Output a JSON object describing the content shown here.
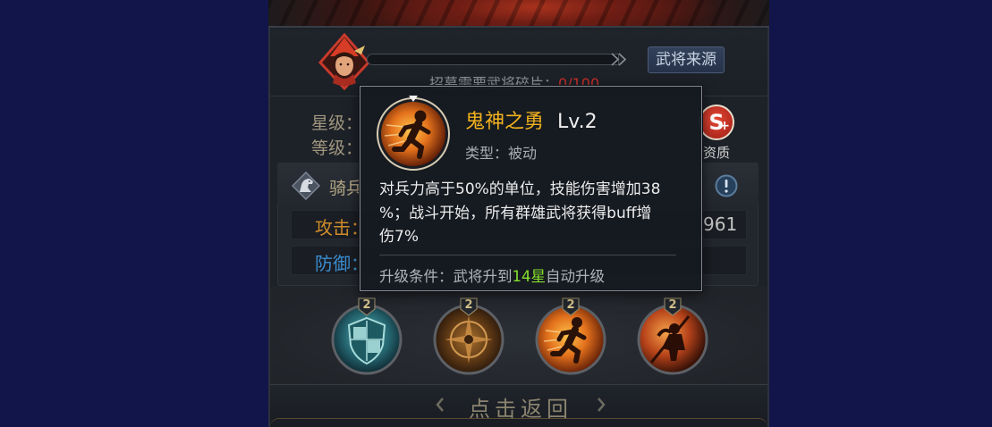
{
  "hero_panel": {
    "recruit": {
      "label": "招募需要武将碎片：",
      "count": "0/100",
      "fraction": 0
    },
    "source_button": "武将来源",
    "star_label": "星级：",
    "level_label": "等级：",
    "grade": {
      "letter": "S",
      "modifier": "+",
      "label": "资质"
    },
    "troop_type": "骑兵",
    "attack": {
      "label": "攻击：",
      "value": "961"
    },
    "defense": {
      "label": "防御："
    },
    "skills": [
      {
        "level": "2",
        "icon": "shield-skill-icon"
      },
      {
        "level": "2",
        "icon": "compass-skill-icon"
      },
      {
        "level": "2",
        "icon": "running-figure-skill-icon"
      },
      {
        "level": "2",
        "icon": "warrior-skill-icon"
      }
    ],
    "back_label": "点击返回"
  },
  "skill_tooltip": {
    "icon": "running-figure-skill-icon",
    "name": "鬼神之勇",
    "level": "Lv.2",
    "type": "类型：被动",
    "description_lines": [
      "对兵力高于50%的单位，技能伤害增加38",
      "%；战斗开始，所有群雄武将获得buff增",
      "伤7%"
    ],
    "upgrade": {
      "prefix": "升级条件：武将升到",
      "highlight": "14星",
      "suffix": "自动升级"
    }
  },
  "icons": {
    "hero": "hero-avatar",
    "progress_arrow": "double-chevron-right-icon",
    "troop": "horse-icon",
    "info": "info-icon",
    "back_left": "chevron-left-icon",
    "back_right": "chevron-right-icon"
  },
  "colors": {
    "page_background": "#12154a",
    "skill_name": "#f2b21e",
    "upgrade_highlight": "#86e02c",
    "recruit_count": "#c9302a",
    "attack_label": "#cf8c2a",
    "defense_label": "#3a8dd0"
  }
}
